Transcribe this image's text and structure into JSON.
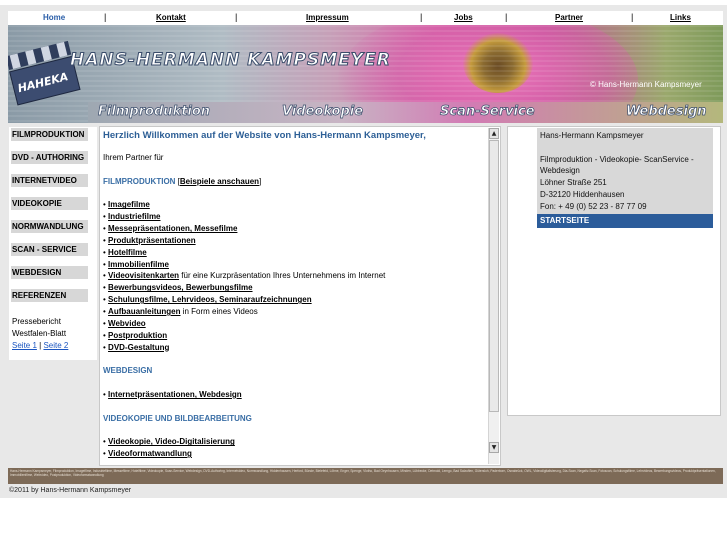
{
  "topnav": {
    "items": [
      "Home",
      "Kontakt",
      "Impressum",
      "Jobs",
      "Partner",
      "Links"
    ],
    "separator": "|"
  },
  "banner": {
    "logo_text": "HAHEKA",
    "title": "HANS-HERMANN KAMPSMEYER",
    "copyright": "Hans-Hermann Kampsmeyer",
    "services": [
      "Filmproduktion",
      "Videokopie",
      "Scan-Service",
      "Webdesign"
    ]
  },
  "leftmenu": {
    "items": [
      "FILMPRODUKTION",
      "DVD - AUTHORING",
      "INTERNETVIDEO",
      "VIDEOKOPIE",
      "NORMWANDLUNG",
      "SCAN - SERVICE",
      "WEBDESIGN",
      "REFERENZEN"
    ],
    "press_label_1": "Pressebericht",
    "press_label_2": "Westfalen-Blatt",
    "press_link_1": "Seite 1",
    "press_sep": "|",
    "press_link_2": "Seite 2"
  },
  "content": {
    "heading": "Herzlich Willkommen auf der Website von Hans-Hermann Kampsmeyer,",
    "intro": "Ihrem Partner für",
    "film_title": "FILMPRODUKTION",
    "film_examples": "Beispiele anschauen",
    "bullet": "•",
    "film_items": [
      {
        "link": "Imagefilme",
        "rest": ""
      },
      {
        "link": "Industriefilme",
        "rest": ""
      },
      {
        "link": "Messepräsentationen, Messefilme",
        "rest": ""
      },
      {
        "link": "Produktpräsentationen",
        "rest": ""
      },
      {
        "link": "Hotelfilme",
        "rest": ""
      },
      {
        "link": "Immobilienfilme",
        "rest": ""
      },
      {
        "link": "Videovisitenkarten",
        "rest": " für eine Kurzpräsentation Ihres Unternehmens im Internet"
      },
      {
        "link": "Bewerbungsvideos, Bewerbungsfilme",
        "rest": ""
      },
      {
        "link": "Schulungsfilme, Lehrvideos, Seminaraufzeichnungen",
        "rest": ""
      },
      {
        "link": "Aufbauanleitungen",
        "rest": " in Form eines Videos"
      },
      {
        "link": "Webvideo",
        "rest": ""
      },
      {
        "link": "Postproduktion",
        "rest": ""
      },
      {
        "link": "DVD-Gestaltung",
        "rest": ""
      }
    ],
    "web_title": "WEBDESIGN",
    "web_items": [
      "Internetpräsentationen, Webdesign"
    ],
    "video_title": "VIDEOKOPIE UND BILDBEARBEITUNG",
    "video_items": [
      "Videokopie, Video-Digitalisierung",
      "Videoformatwandlung"
    ]
  },
  "scrollbar": {
    "up": "▲",
    "down": "▼"
  },
  "contact": {
    "name": "Hans-Hermann Kampsmeyer",
    "services": "Filmproduktion - Videokopie- ScanService - Webdesign",
    "street": "Löhner Straße 251",
    "city": "D-32120 Hiddenhausen",
    "phone": "Fon: + 49 (0) 52 23 - 87 77 09",
    "start_label": "STARTSEITE"
  },
  "footer": {
    "tags": "Hans-Hermann Kampsmeyer, Filmproduktion, Imagefilme, Industriefilme, Messefilme, Hotelfilme, Videokopie, Scan-Service, Webdesign, DVD-Authoring, Internetvideo, Normwandlung, Hiddenhausen, Herford, Bünde, Bielefeld, Löhne, Enger, Spenge, Vlotho, Bad Oeynhausen, Minden, Lübbecke, Detmold, Lemgo, Bad Salzuflen, Gütersloh, Paderborn, Osnabrück, OWL, Videodigitalisierung, Dia-Scan, Negativ-Scan, Fotoscan, Schulungsfilme, Lehrvideos, Bewerbungsvideos, Produktpräsentationen, Immobilienfilme, Webvideo, Postproduktion, Videoformatwandlung",
    "copyright": "©2011 by Hans-Hermann Kampsmeyer"
  }
}
